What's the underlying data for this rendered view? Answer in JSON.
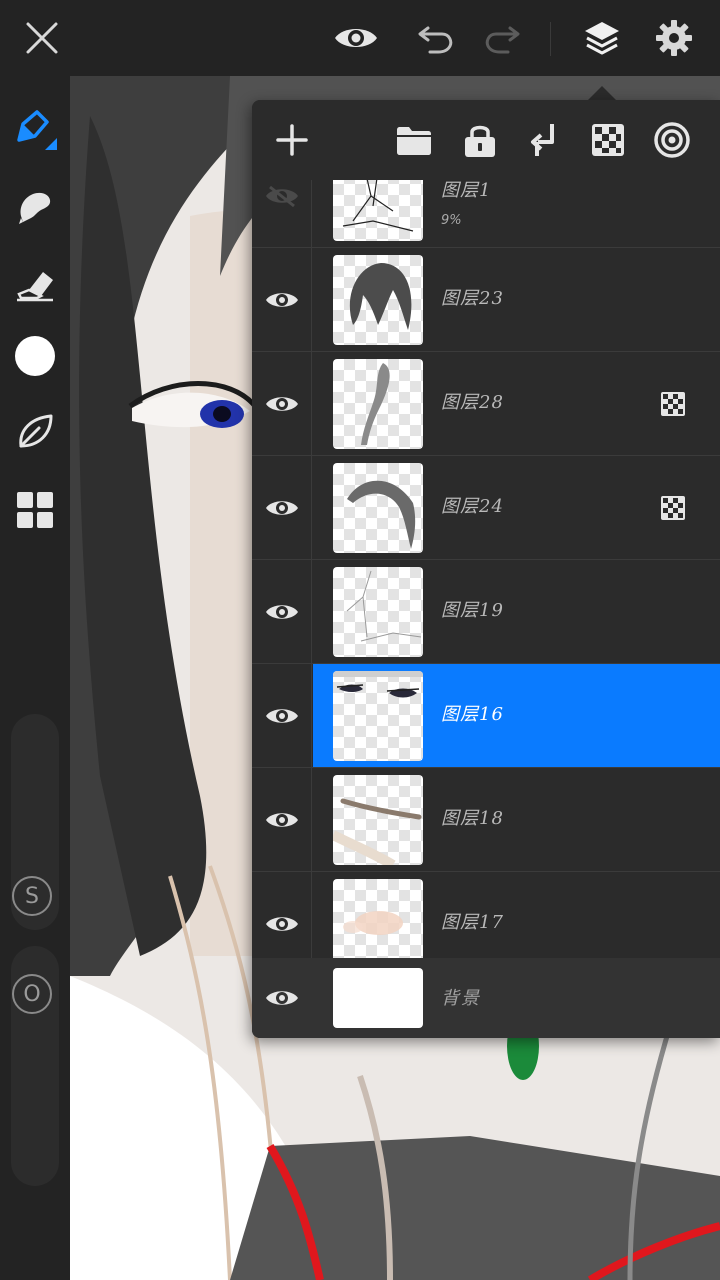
{
  "colors": {
    "accent": "#0a7bff",
    "toolbar_bg": "#232323",
    "panel_bg": "#2b2b2b",
    "selected_row": "#0a7bff"
  },
  "topbar": {
    "icons": [
      "close-icon",
      "eye-icon",
      "undo-icon",
      "redo-icon",
      "layers-icon",
      "settings-icon"
    ]
  },
  "sidebar": {
    "tools": [
      "brush-tool-icon",
      "smudge-tool-icon",
      "eraser-tool-icon",
      "color-swatch",
      "leaf-icon",
      "gallery-grid-icon"
    ],
    "size_label": "S",
    "opacity_label": "O"
  },
  "layers_panel": {
    "toolbar_icons": [
      "add-layer-icon",
      "folder-icon",
      "lock-icon",
      "merge-down-icon",
      "alpha-lock-icon",
      "blend-icon"
    ],
    "layers": [
      {
        "name": "图层1",
        "opacity": "9%",
        "visible": false,
        "selected": false,
        "alpha_lock": false
      },
      {
        "name": "图层23",
        "visible": true,
        "selected": false,
        "alpha_lock": false
      },
      {
        "name": "图层28",
        "visible": true,
        "selected": false,
        "alpha_lock": true
      },
      {
        "name": "图层24",
        "visible": true,
        "selected": false,
        "alpha_lock": true
      },
      {
        "name": "图层19",
        "visible": true,
        "selected": false,
        "alpha_lock": false
      },
      {
        "name": "图层16",
        "visible": true,
        "selected": true,
        "alpha_lock": false
      },
      {
        "name": "图层18",
        "visible": true,
        "selected": false,
        "alpha_lock": false
      },
      {
        "name": "图层17",
        "visible": true,
        "selected": false,
        "alpha_lock": false
      }
    ],
    "background": {
      "name": "背景",
      "visible": true
    }
  }
}
